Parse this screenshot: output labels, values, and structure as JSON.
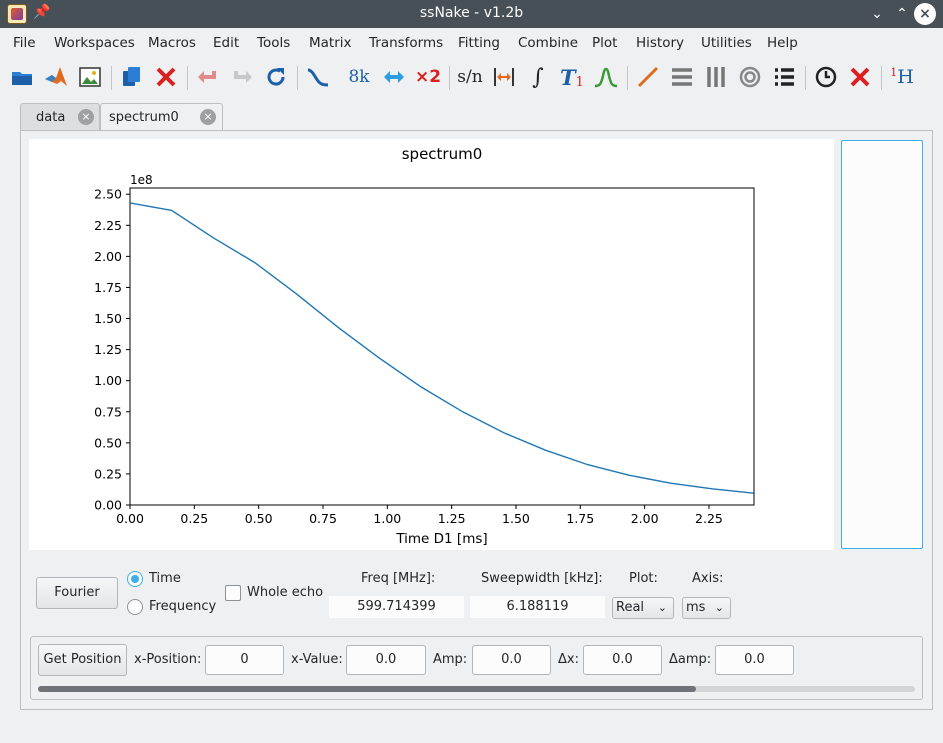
{
  "window": {
    "title": "ssNake - v1.2b"
  },
  "menu": [
    "File",
    "Workspaces",
    "Macros",
    "Edit",
    "Tools",
    "Matrix",
    "Transforms",
    "Fitting",
    "Combine",
    "Plot",
    "History",
    "Utilities",
    "Help"
  ],
  "toolbar": {
    "icons": [
      "open-folder-icon",
      "matlab-icon",
      "image-export-icon",
      "duplicate-icon",
      "delete-icon",
      "undo-icon",
      "redo-icon",
      "reload-icon",
      "phase-icon",
      "size-icon",
      "swap-echo-icon",
      "multiply-icon",
      "signal-to-noise-icon",
      "integrate-region-icon",
      "integral-icon",
      "t1-icon",
      "peak-fit-icon",
      "line-icon",
      "stack-rows-icon",
      "stack-columns-icon",
      "contour-icon",
      "list-icon",
      "clock-icon",
      "clear-icon",
      "nmr-table-icon"
    ],
    "sn_label": "s/n",
    "size_label": "8k",
    "mult_label": "×2",
    "integral_label": "∫",
    "t1_label": "T",
    "t1_sub": "1",
    "h_sup": "1",
    "h_label": "H"
  },
  "tabs": [
    {
      "label": "data",
      "active": false
    },
    {
      "label": "spectrum0",
      "active": true
    }
  ],
  "chart_data": {
    "type": "line",
    "title": "spectrum0",
    "xlabel": "Time D1 [ms]",
    "ylabel": "",
    "y_scale_label": "1e8",
    "xlim": [
      0.0,
      2.425
    ],
    "ylim": [
      0.0,
      2.55
    ],
    "x_ticks": [
      "0.00",
      "0.25",
      "0.50",
      "0.75",
      "1.00",
      "1.25",
      "1.50",
      "1.75",
      "2.00",
      "2.25"
    ],
    "x_tick_values": [
      0,
      0.25,
      0.5,
      0.75,
      1.0,
      1.25,
      1.5,
      1.75,
      2.0,
      2.25
    ],
    "y_ticks": [
      "0.00",
      "0.25",
      "0.50",
      "0.75",
      "1.00",
      "1.25",
      "1.50",
      "1.75",
      "2.00",
      "2.25",
      "2.50"
    ],
    "y_tick_values": [
      0,
      0.25,
      0.5,
      0.75,
      1.0,
      1.25,
      1.5,
      1.75,
      2.0,
      2.25,
      2.5
    ],
    "grid": false,
    "series": [
      {
        "color": "#1f77b4",
        "x": [
          0.0,
          0.162,
          0.323,
          0.485,
          0.646,
          0.808,
          0.97,
          1.131,
          1.293,
          1.454,
          1.616,
          1.778,
          1.939,
          2.101,
          2.262,
          2.424
        ],
        "y": [
          2.43,
          2.37,
          2.15,
          1.95,
          1.7,
          1.43,
          1.18,
          0.95,
          0.75,
          0.58,
          0.44,
          0.325,
          0.24,
          0.175,
          0.13,
          0.095
        ]
      }
    ]
  },
  "controls": {
    "fourier_button": "Fourier",
    "radio_time": "Time",
    "radio_frequency": "Frequency",
    "time_selected": true,
    "whole_echo": "Whole echo",
    "whole_echo_checked": false,
    "freq_label": "Freq [MHz]:",
    "freq_value": "599.714399",
    "sweep_label": "Sweepwidth [kHz]:",
    "sweep_value": "6.188119",
    "plot_label": "Plot:",
    "plot_value": "Real",
    "axis_label": "Axis:",
    "axis_value": "ms"
  },
  "position": {
    "get_button": "Get Position",
    "xpos_label": "x-Position:",
    "xpos_value": "0",
    "xval_label": "x-Value:",
    "xval_value": "0.0",
    "amp_label": "Amp:",
    "amp_value": "0.0",
    "dx_label": "Δx:",
    "dx_value": "0.0",
    "damp_label": "Δamp:",
    "damp_value": "0.0"
  },
  "scrollbar": {
    "position_fraction": 0.75
  },
  "colors": {
    "accent": "#3daee9",
    "titlebar": "#475057",
    "line": "#1f77b4"
  }
}
